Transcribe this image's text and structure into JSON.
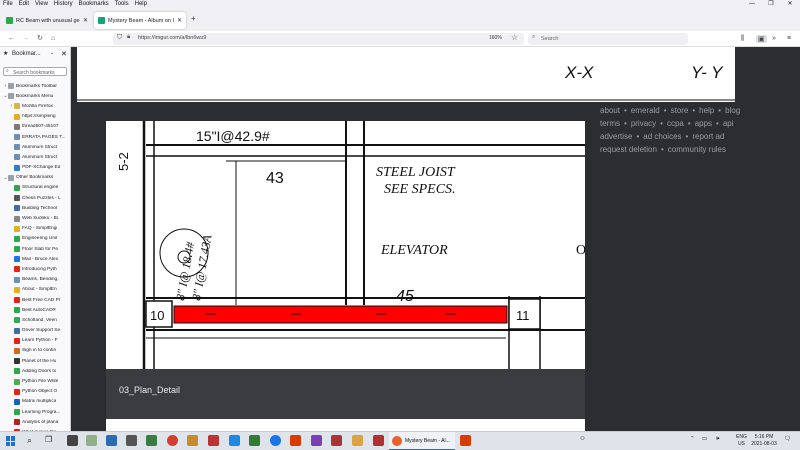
{
  "menubar": {
    "items": [
      "File",
      "Edit",
      "View",
      "History",
      "Bookmarks",
      "Tools",
      "Help"
    ],
    "minimize": "—",
    "maximize": "❐",
    "close": "✕"
  },
  "tabs": [
    {
      "title": "RC Beam with unusual geometr",
      "favicon_color": "#2aa84a",
      "active": false
    },
    {
      "title": "Mystery Beam - Album on Imgu",
      "favicon_color": "#17a37a",
      "active": true
    }
  ],
  "newtab_label": "+",
  "navbar": {
    "back": "←",
    "forward": "→",
    "reload": "↻",
    "home": "⌂",
    "url": "https://imgur.com/a/lbn6wu9",
    "zoom": "160%",
    "search_placeholder": "Search"
  },
  "sidebar": {
    "title": "Bookmar...",
    "search_placeholder": "Search bookmarks",
    "items": [
      {
        "label": "Bookmarks Toolbar",
        "indent": 1,
        "twisty": "›",
        "icon": "folder-icon",
        "color": "#9aa0a6"
      },
      {
        "label": "Bookmarks Menu",
        "indent": 1,
        "twisty": "⌄",
        "icon": "folder-icon",
        "color": "#9aa0a6"
      },
      {
        "label": "Mozilla Firefox",
        "indent": 2,
        "twisty": "›",
        "icon": "folder-icon",
        "color": "#d9b44a"
      },
      {
        "label": "https://simpleng",
        "indent": 2,
        "twisty": "",
        "icon": "bulb-icon",
        "color": "#e0b020"
      },
      {
        "label": "thread507-45107",
        "indent": 2,
        "twisty": "",
        "icon": "page-icon",
        "color": "#7a7a7a"
      },
      {
        "label": "ERRATA PAGES T...",
        "indent": 2,
        "twisty": "",
        "icon": "globe-icon",
        "color": "#6b8fb5"
      },
      {
        "label": "Aluminum Struct",
        "indent": 2,
        "twisty": "",
        "icon": "globe-icon",
        "color": "#6b8fb5"
      },
      {
        "label": "Aluminum Struct",
        "indent": 2,
        "twisty": "",
        "icon": "globe-icon",
        "color": "#6b8fb5"
      },
      {
        "label": "PDF-XChange Ed",
        "indent": 2,
        "twisty": "",
        "icon": "pdf-icon",
        "color": "#2e7bcf"
      },
      {
        "label": "Other Bookmarks",
        "indent": 1,
        "twisty": "⌄",
        "icon": "folder-icon",
        "color": "#9aa0a6"
      },
      {
        "label": "Structural engine",
        "indent": 2,
        "twisty": "",
        "icon": "tt-icon",
        "color": "#2aa84a"
      },
      {
        "label": "Chess Puzzles - L",
        "indent": 2,
        "twisty": "",
        "icon": "chess-icon",
        "color": "#555555"
      },
      {
        "label": "Building Technol",
        "indent": 2,
        "twisty": "",
        "icon": "page-icon",
        "color": "#3b6ea5"
      },
      {
        "label": "Web Sudoku - Bi",
        "indent": 2,
        "twisty": "",
        "icon": "grid-icon",
        "color": "#888888"
      },
      {
        "label": "FAQ - SimplEngi",
        "indent": 2,
        "twisty": "",
        "icon": "bulb-icon",
        "color": "#e0b020"
      },
      {
        "label": "Engineering Unit",
        "indent": 2,
        "twisty": "",
        "icon": "tt-icon",
        "color": "#2aa84a"
      },
      {
        "label": "Floor Slab for Pe",
        "indent": 2,
        "twisty": "",
        "icon": "tt-icon",
        "color": "#2aa84a"
      },
      {
        "label": "Mail - Bruce Alex",
        "indent": 2,
        "twisty": "",
        "icon": "mail-icon",
        "color": "#1a73e8"
      },
      {
        "label": "Introducing Pyth",
        "indent": 2,
        "twisty": "",
        "icon": "youtube-icon",
        "color": "#e62117"
      },
      {
        "label": "Beams, Bending,",
        "indent": 2,
        "twisty": "",
        "icon": "globe-icon",
        "color": "#6b8fb5"
      },
      {
        "label": "About - SimplEn",
        "indent": 2,
        "twisty": "",
        "icon": "bulb-icon",
        "color": "#e0b020"
      },
      {
        "label": "Best Free CAD Pr",
        "indent": 2,
        "twisty": "",
        "icon": "youtube-icon",
        "color": "#e62117"
      },
      {
        "label": "Best AutoCAD®",
        "indent": 2,
        "twisty": "",
        "icon": "tt-icon",
        "color": "#2aa84a"
      },
      {
        "label": "Schofland, Veen",
        "indent": 2,
        "twisty": "",
        "icon": "map-pin-icon",
        "color": "#34a853"
      },
      {
        "label": "Driver Support Se",
        "indent": 2,
        "twisty": "",
        "icon": "page-icon",
        "color": "#3b6ea5"
      },
      {
        "label": "Learn Python - F",
        "indent": 2,
        "twisty": "",
        "icon": "youtube-icon",
        "color": "#e62117"
      },
      {
        "label": "Sign in to contin",
        "indent": 2,
        "twisty": "",
        "icon": "page-icon",
        "color": "#d2691e"
      },
      {
        "label": "Planet of the Hu",
        "indent": 2,
        "twisty": "",
        "icon": "page-icon",
        "color": "#333333"
      },
      {
        "label": "Adding Doors to",
        "indent": 2,
        "twisty": "",
        "icon": "tt-icon",
        "color": "#2aa84a"
      },
      {
        "label": "Python File Write",
        "indent": 2,
        "twisty": "",
        "icon": "w-icon",
        "color": "#4caf50"
      },
      {
        "label": "Python Object O",
        "indent": 2,
        "twisty": "",
        "icon": "youtube-icon",
        "color": "#e62117"
      },
      {
        "label": "Matrix multiplica",
        "indent": 2,
        "twisty": "",
        "icon": "page-icon",
        "color": "#1565c0"
      },
      {
        "label": "Learning Progra...",
        "indent": 2,
        "twisty": "",
        "icon": "tt-icon",
        "color": "#2aa84a"
      },
      {
        "label": "Analysis of plana",
        "indent": 2,
        "twisty": "",
        "icon": "page-icon",
        "color": "#b22222"
      },
      {
        "label": "What makes the",
        "indent": 2,
        "twisty": "",
        "icon": "youtube-icon",
        "color": "#e62117"
      }
    ]
  },
  "page": {
    "scan_top_labels": [
      "X-X",
      "Y- Y"
    ],
    "drawing_labels": {
      "beam_callout": "15\"I@42.9#",
      "joist": "STEEL JOIST",
      "specs": "SEE SPECS.",
      "elevator": "ELEVATOR",
      "elevator_tail": "O",
      "num_43": "43",
      "num_45": "45",
      "num_10": "10",
      "num_11": "11",
      "num_5": "5-2",
      "vert1": "8\" I@ 18.4#",
      "vert2": "8\" I@ 17.43A",
      "highlight_color": "#ff0000"
    },
    "caption": "03_Plan_Detail",
    "footer_links": [
      [
        "about",
        "emerald",
        "store",
        "help",
        "blog"
      ],
      [
        "terms",
        "privacy",
        "ccpa",
        "apps",
        "api"
      ],
      [
        "advertise",
        "ad choices",
        "report ad"
      ],
      [
        "request deletion",
        "community rules"
      ]
    ]
  },
  "taskbar": {
    "active_window": "Mystery Beam - Al...",
    "tray_lang": "ENG",
    "tray_region": "US",
    "time": "5:16 PM",
    "date": "2021-08-03"
  }
}
